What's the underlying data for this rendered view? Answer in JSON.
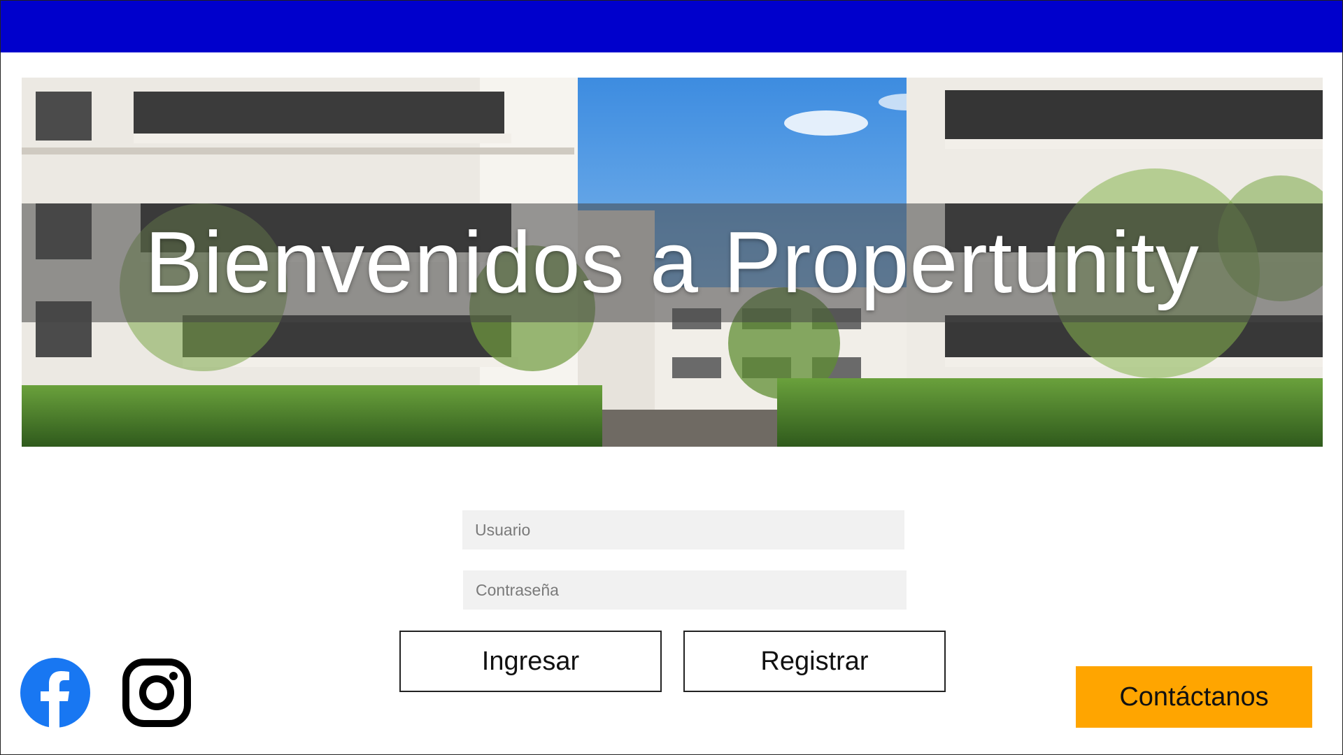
{
  "hero": {
    "title": "Bienvenidos a Propertunity"
  },
  "login": {
    "user_placeholder": "Usuario",
    "password_placeholder": "Contraseña",
    "login_label": "Ingresar",
    "register_label": "Registrar"
  },
  "contact": {
    "label": "Contáctanos"
  },
  "social": {
    "icons": [
      "facebook-icon",
      "instagram-icon"
    ]
  },
  "colors": {
    "topbar": "#0000cc",
    "contact_button": "#ffa500",
    "facebook": "#1877f2"
  }
}
